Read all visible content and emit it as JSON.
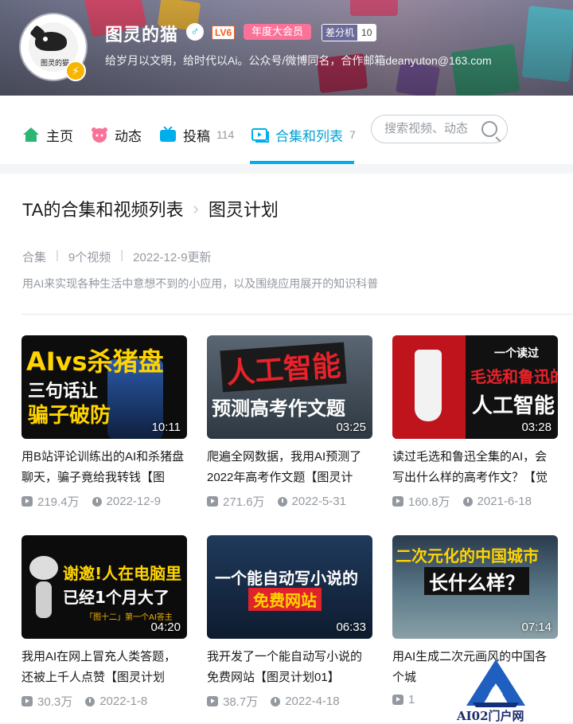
{
  "profile": {
    "name": "图灵的猫",
    "gender_symbol": "♂",
    "level": "LV6",
    "vip_label": "年度大会员",
    "badge_name": "差分机",
    "badge_level": "10",
    "signature": "给岁月以文明，给时代以Ai。公众号/微博同名，合作邮箱deanyuton@163.com",
    "avatar_text": "图灵的猫"
  },
  "nav": {
    "items": [
      {
        "label": "主页",
        "count": ""
      },
      {
        "label": "动态",
        "count": ""
      },
      {
        "label": "投稿",
        "count": "114"
      },
      {
        "label": "合集和列表",
        "count": "7"
      }
    ],
    "search_placeholder": "搜索视频、动态"
  },
  "collection": {
    "breadcrumb_root": "TA的合集和视频列表",
    "breadcrumb_current": "图灵计划",
    "type": "合集",
    "video_count": "9个视频",
    "updated": "2022-12-9更新",
    "description": "用AI来实现各种生活中意想不到的小应用，以及围绕应用展开的知识科普"
  },
  "videos": [
    {
      "thumb_line1": "AIvs杀猪盘",
      "thumb_line2": "三句话让",
      "thumb_line3": "骗子破防",
      "duration": "10:11",
      "title": "用B站评论训练出的AI和杀猪盘聊天，骗子竟给我转钱【图",
      "views": "219.4万",
      "date": "2022-12-9"
    },
    {
      "thumb_line1": "人工智能",
      "thumb_line2": "预测高考作文题",
      "duration": "03:25",
      "title": "爬遍全网数据，我用AI预测了2022年高考作文题【图灵计",
      "views": "271.6万",
      "date": "2022-5-31"
    },
    {
      "thumb_line1": "一个读过",
      "thumb_line2": "毛选和鲁迅的",
      "thumb_line3": "人工智能",
      "duration": "03:28",
      "title": "读过毛选和鲁迅全集的AI，会写出什么样的高考作文？【觉",
      "views": "160.8万",
      "date": "2021-6-18"
    },
    {
      "thumb_line1": "谢邀!人在电脑里",
      "thumb_line2": "已经1个月大了",
      "thumb_line3": "「图十二」第一个AI答主",
      "duration": "04:20",
      "title": "我用AI在网上冒充人类答题，还被上千人点赞【图灵计划",
      "views": "30.3万",
      "date": "2022-1-8"
    },
    {
      "thumb_line1": "一个能自动写小说的",
      "thumb_line2": "免费网站",
      "duration": "06:33",
      "title": "我开发了一个能自动写小说的免费网站【图灵计划01】",
      "views": "38.7万",
      "date": "2022-4-18"
    },
    {
      "thumb_line1": "二次元化的中国城市",
      "thumb_line2": "长什么样？",
      "duration": "07:14",
      "title": "用AI生成二次元画风的中国各个城",
      "views": "1",
      "date": ""
    }
  ],
  "watermark": {
    "text": "AI02门户网"
  }
}
